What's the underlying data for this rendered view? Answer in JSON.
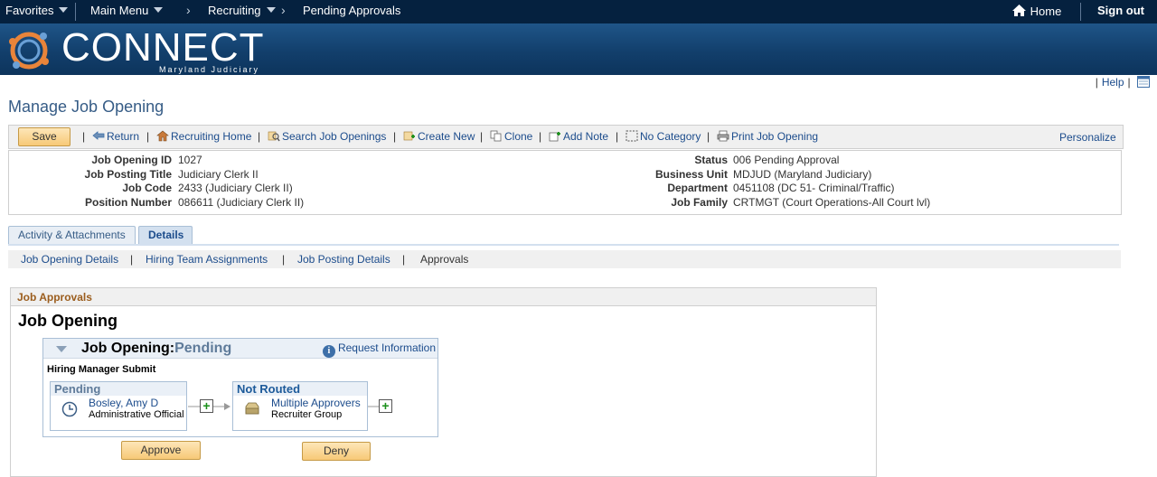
{
  "topnav": {
    "favorites": "Favorites",
    "main_menu": "Main Menu",
    "crumb_recruiting": "Recruiting",
    "crumb_current": "Pending Approvals",
    "home": "Home",
    "sign_out": "Sign out"
  },
  "banner": {
    "brand": "CONNECT",
    "sub": "Maryland Judiciary"
  },
  "helpbar": {
    "help": "Help"
  },
  "page_title": "Manage Job Opening",
  "toolbar": {
    "save": "Save",
    "return": "Return",
    "recruiting_home": "Recruiting Home",
    "search_job_openings": "Search Job Openings",
    "create_new": "Create New",
    "clone": "Clone",
    "add_note": "Add Note",
    "no_category": "No Category",
    "print_job_opening": "Print Job Opening",
    "personalize": "Personalize"
  },
  "info": {
    "left": [
      {
        "label": "Job Opening ID",
        "value": "1027"
      },
      {
        "label": "Job Posting Title",
        "value": "Judiciary Clerk II"
      },
      {
        "label": "Job Code",
        "value": "2433 (Judiciary Clerk II)"
      },
      {
        "label": "Position Number",
        "value": "086611 (Judiciary Clerk II)"
      }
    ],
    "right": [
      {
        "label": "Status",
        "value": "006 Pending Approval"
      },
      {
        "label": "Business Unit",
        "value": "MDJUD (Maryland Judiciary)"
      },
      {
        "label": "Department",
        "value": "0451108 (DC 51- Criminal/Traffic)"
      },
      {
        "label": "Job Family",
        "value": "CRTMGT (Court Operations-All Court lvl)"
      }
    ]
  },
  "tabs": [
    {
      "label": "Activity & Attachments"
    },
    {
      "label": "Details"
    }
  ],
  "subnav": [
    {
      "label": "Job Opening Details"
    },
    {
      "label": "Hiring Team Assignments"
    },
    {
      "label": "Job Posting Details"
    },
    {
      "label": "Approvals"
    }
  ],
  "approvals": {
    "section_title": "Job Approvals",
    "heading": "Job Opening",
    "flow_title": "Job Opening:",
    "flow_status": "Pending",
    "request_info": "Request Information",
    "step_name": "Hiring Manager Submit",
    "stages": [
      {
        "status": "Pending",
        "name": "Bosley, Amy D",
        "role": "Administrative Official"
      },
      {
        "status": "Not Routed",
        "name": "Multiple Approvers",
        "role": "Recruiter Group"
      }
    ],
    "approve": "Approve",
    "deny": "Deny"
  }
}
